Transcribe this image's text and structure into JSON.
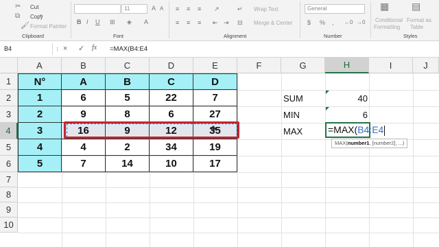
{
  "ribbon": {
    "clipboard": {
      "cut": "Cut",
      "copy": "Copy",
      "format_painter": "Format Painter",
      "group_label": "Clipboard"
    },
    "font": {
      "font_size": "11",
      "group_label": "Font"
    },
    "alignment": {
      "wrap_text": "Wrap Text",
      "merge_center": "Merge & Center",
      "group_label": "Alignment"
    },
    "number": {
      "format": "General",
      "group_label": "Number"
    },
    "styles": {
      "conditional_1": "Conditional",
      "conditional_2": "Formatting",
      "format_table_1": "Format as",
      "format_table_2": "Table",
      "group_label": "Styles"
    }
  },
  "formula_bar": {
    "name_box": "B4",
    "cancel_icon": "×",
    "enter_icon": "✓",
    "fx": "fx",
    "formula": "=MAX(B4:E4"
  },
  "columns": [
    "A",
    "B",
    "C",
    "D",
    "E",
    "F",
    "G",
    "H",
    "I",
    "J"
  ],
  "rows": [
    "1",
    "2",
    "3",
    "4",
    "5",
    "6",
    "7",
    "8",
    "9",
    "10"
  ],
  "table": {
    "header": [
      "N°",
      "A",
      "B",
      "C",
      "D"
    ],
    "rows": [
      [
        "1",
        "6",
        "5",
        "22",
        "7"
      ],
      [
        "2",
        "9",
        "8",
        "6",
        "27"
      ],
      [
        "3",
        "16",
        "9",
        "12",
        "35"
      ],
      [
        "4",
        "4",
        "2",
        "34",
        "19"
      ],
      [
        "5",
        "7",
        "14",
        "10",
        "17"
      ]
    ]
  },
  "summary": [
    {
      "label": "SUM",
      "value": "40"
    },
    {
      "label": "MIN",
      "value": "6"
    },
    {
      "label": "MAX",
      "value": ""
    }
  ],
  "edit": {
    "prefix": "=MAX(",
    "range": "B4:E4"
  },
  "tooltip": {
    "func": "MAX(",
    "arg1": "number1",
    "rest": ", [number2], ...)"
  },
  "colors": {
    "table_fill": "#a4f0f6",
    "highlight": "#c0262d",
    "excel_green": "#217346"
  }
}
